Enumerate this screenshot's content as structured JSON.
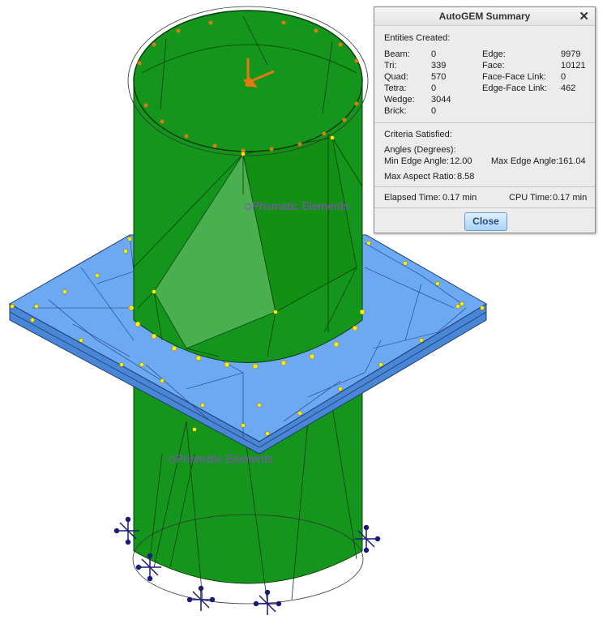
{
  "dialog": {
    "title": "AutoGEM Summary",
    "close_x": "✕",
    "entities_header": "Entities Created:",
    "entities_left": [
      {
        "label": "Beam:",
        "value": "0"
      },
      {
        "label": "Tri:",
        "value": "339"
      },
      {
        "label": "Quad:",
        "value": "570"
      },
      {
        "label": "Tetra:",
        "value": "0"
      },
      {
        "label": "Wedge:",
        "value": "3044"
      },
      {
        "label": "Brick:",
        "value": "0"
      }
    ],
    "entities_right": [
      {
        "label": "Edge:",
        "value": "9979"
      },
      {
        "label": "Face:",
        "value": "10121"
      },
      {
        "label": "Face-Face Link:",
        "value": "0"
      },
      {
        "label": "Edge-Face Link:",
        "value": "462"
      }
    ],
    "criteria_header": "Criteria Satisfied:",
    "angles_header": "Angles (Degrees):",
    "min_edge_angle_label": "Min Edge Angle:",
    "min_edge_angle_value": "12.00",
    "max_edge_angle_label": "Max Edge Angle:",
    "max_edge_angle_value": "161.04",
    "max_aspect_label": "Max Aspect Ratio:",
    "max_aspect_value": "8.58",
    "elapsed_label": "Elapsed Time:",
    "elapsed_value": "0.17 min",
    "cpu_label": "CPU Time:",
    "cpu_value": "0.17 min",
    "close_button": "Close"
  },
  "labels": {
    "prismatic_upper": "Prismatic Elements",
    "prismatic_lower": "Prismatic Elements"
  },
  "colors": {
    "cylinder_green": "#14961c",
    "plate_blue": "#6da8f2",
    "mesh_node_yellow": "#ffee00",
    "load_arrow_orange": "#e07a10",
    "constraint_navy": "#1a1a7a"
  }
}
